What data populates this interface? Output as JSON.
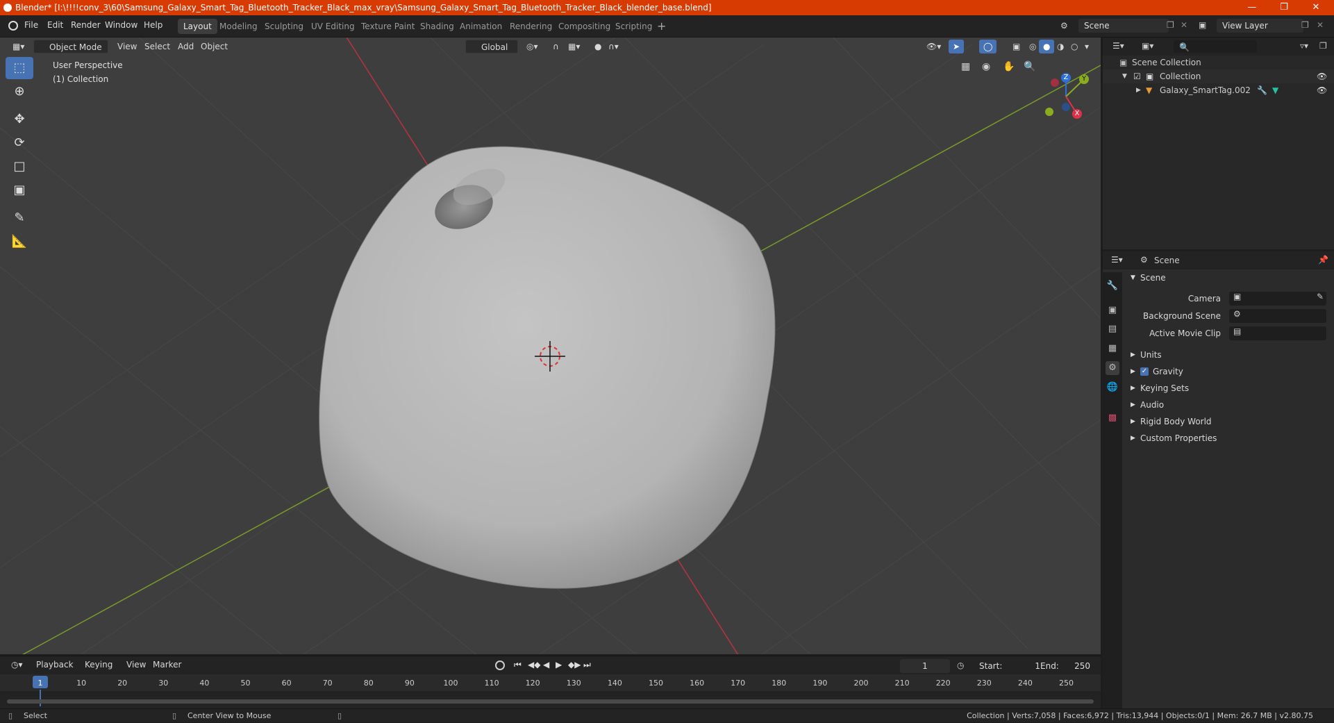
{
  "titlebar": {
    "title": "Blender* [I:\\!!!!conv_3\\60\\Samsung_Galaxy_Smart_Tag_Bluetooth_Tracker_Black_max_vray\\Samsung_Galaxy_Smart_Tag_Bluetooth_Tracker_Black_blender_base.blend]"
  },
  "menu": [
    "File",
    "Edit",
    "Render",
    "Window",
    "Help"
  ],
  "workspaces": [
    "Layout",
    "Modeling",
    "Sculpting",
    "UV Editing",
    "Texture Paint",
    "Shading",
    "Animation",
    "Rendering",
    "Compositing",
    "Scripting"
  ],
  "scene_field": "Scene",
  "view_layer_field": "View Layer",
  "viewport_header": {
    "mode": "Object Mode",
    "menus": [
      "View",
      "Select",
      "Add",
      "Object"
    ],
    "orientation": "Global"
  },
  "viewport": {
    "perspective_label": "User Perspective",
    "collection_label": "(1) Collection"
  },
  "gizmo": {
    "z": "Z",
    "y": "Y",
    "x": "X"
  },
  "outliner": {
    "root": "Scene Collection",
    "collection": "Collection",
    "object": "Galaxy_SmartTag.002"
  },
  "properties": {
    "header": "Scene",
    "panel": "Scene",
    "fields": [
      {
        "label": "Camera"
      },
      {
        "label": "Background Scene"
      },
      {
        "label": "Active Movie Clip"
      }
    ],
    "subpanels": [
      "Units",
      "Gravity",
      "Keying Sets",
      "Audio",
      "Rigid Body World",
      "Custom Properties"
    ]
  },
  "timeline": {
    "menus": [
      "Playback",
      "Keying",
      "View",
      "Marker"
    ],
    "current_frame": "1",
    "start_label": "Start:",
    "start": "1",
    "end_label": "End:",
    "end": "250",
    "ticks": [
      "1",
      "10",
      "20",
      "30",
      "40",
      "50",
      "60",
      "70",
      "80",
      "90",
      "100",
      "110",
      "120",
      "130",
      "140",
      "150",
      "160",
      "170",
      "180",
      "190",
      "200",
      "210",
      "220",
      "230",
      "240",
      "250"
    ]
  },
  "statusbar": {
    "left": "Select",
    "middle": "Center View to Mouse",
    "right": "Collection | Verts:7,058 | Faces:6,972 | Tris:13,944 | Objects:0/1 | Mem: 26.7 MB | v2.80.75"
  },
  "colors": {
    "titlebar": "#d83b01",
    "active_tool": "#4772b3",
    "x_axis": "#b5343f",
    "y_axis": "#7a9a2a"
  }
}
